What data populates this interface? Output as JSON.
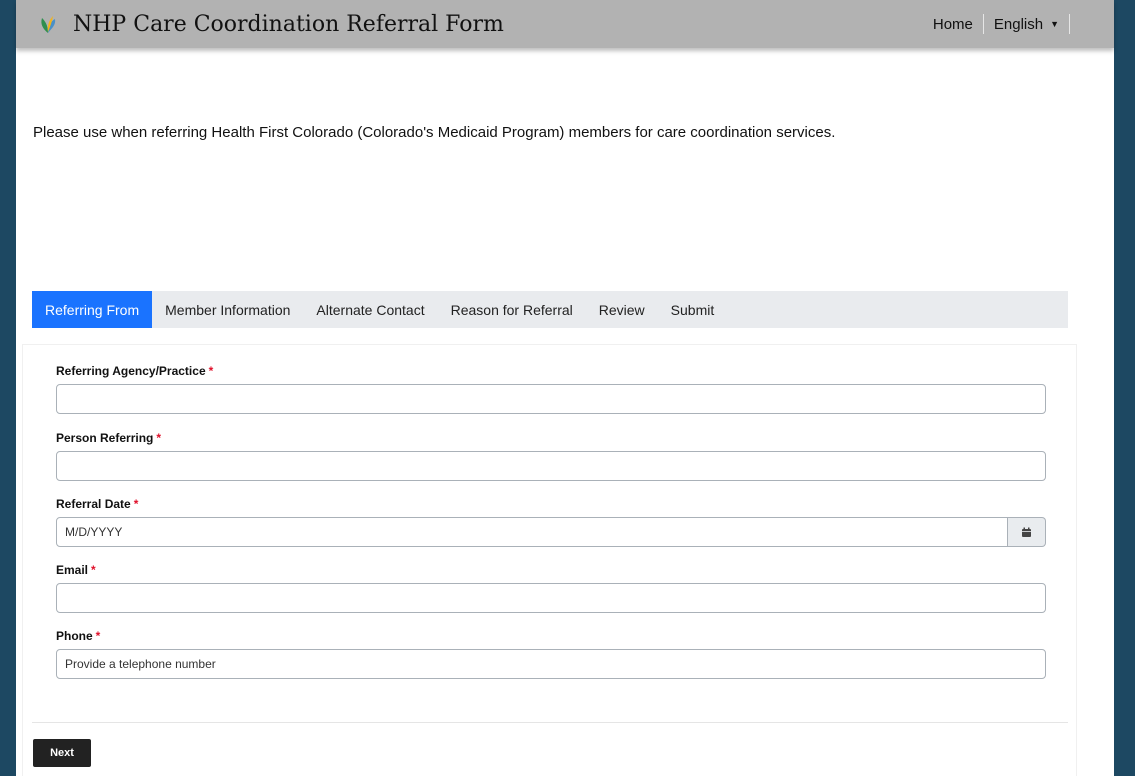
{
  "header": {
    "title": "NHP Care Coordination Referral Form",
    "logo_icon": "nhp-leaf-logo-icon",
    "nav_home": "Home",
    "nav_language": "English",
    "background": "#b2b2b2"
  },
  "intro_text": "Please use when referring Health First Colorado (Colorado's Medicaid Program) members for care coordination services.",
  "tabs": [
    {
      "label": "Referring From",
      "active": true
    },
    {
      "label": "Member Information",
      "active": false
    },
    {
      "label": "Alternate Contact",
      "active": false
    },
    {
      "label": "Reason for Referral",
      "active": false
    },
    {
      "label": "Review",
      "active": false
    },
    {
      "label": "Submit",
      "active": false
    }
  ],
  "form": {
    "required_marker": "*",
    "agency": {
      "label": "Referring Agency/Practice",
      "value": ""
    },
    "person": {
      "label": "Person Referring",
      "value": ""
    },
    "date": {
      "label": "Referral Date",
      "placeholder": "M/D/YYYY",
      "icon": "calendar-icon"
    },
    "email": {
      "label": "Email",
      "value": ""
    },
    "phone": {
      "label": "Phone",
      "placeholder": "Provide a telephone number"
    }
  },
  "next_label": "Next",
  "colors": {
    "accent": "#1a73ff",
    "page_background": "#1d4862",
    "required": "#e0102a",
    "button": "#222222"
  }
}
